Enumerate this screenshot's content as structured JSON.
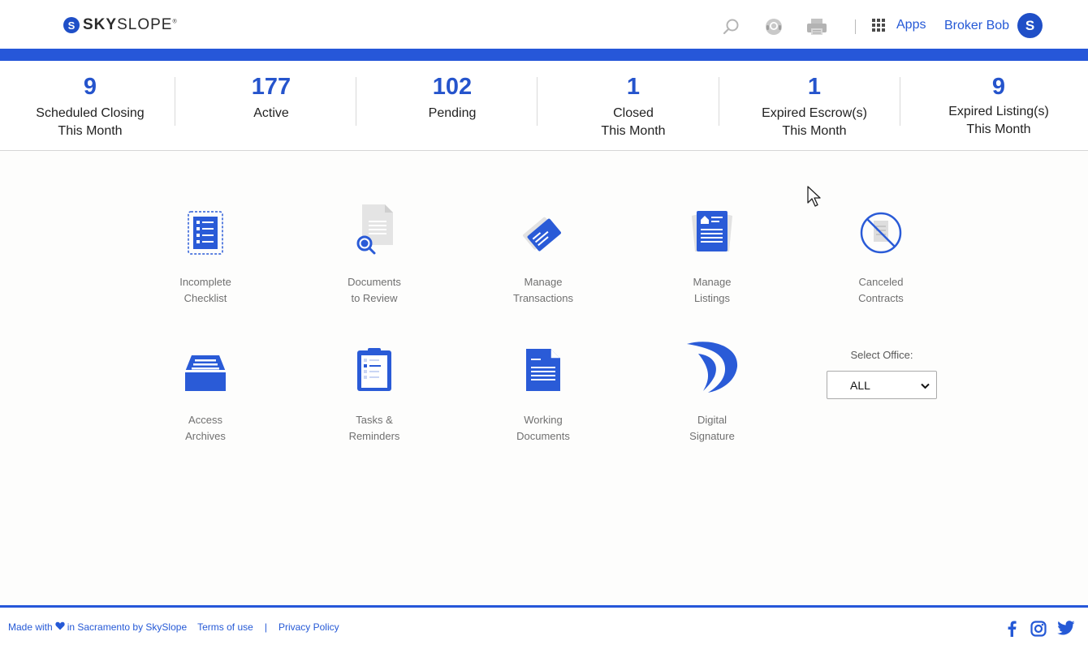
{
  "brand": {
    "logo_text_bold": "SKY",
    "logo_text_light": "SLOPE",
    "registered": "®"
  },
  "header": {
    "apps_label": "Apps",
    "user_name": "Broker Bob",
    "accent": "#2657d9"
  },
  "stats": [
    {
      "value": "9",
      "label_line1": "Scheduled Closing",
      "label_line2": "This Month"
    },
    {
      "value": "177",
      "label_line1": "Active",
      "label_line2": ""
    },
    {
      "value": "102",
      "label_line1": "Pending",
      "label_line2": ""
    },
    {
      "value": "1",
      "label_line1": "Closed",
      "label_line2": "This Month"
    },
    {
      "value": "1",
      "label_line1": "Expired Escrow(s)",
      "label_line2": "This Month"
    },
    {
      "value": "9",
      "label_line1": "Expired Listing(s)",
      "label_line2": "This Month"
    }
  ],
  "tiles": [
    {
      "icon": "checklist-icon",
      "line1": "Incomplete",
      "line2": "Checklist"
    },
    {
      "icon": "document-review-icon",
      "line1": "Documents",
      "line2": "to Review"
    },
    {
      "icon": "transactions-icon",
      "line1": "Manage",
      "line2": "Transactions"
    },
    {
      "icon": "listings-icon",
      "line1": "Manage",
      "line2": "Listings"
    },
    {
      "icon": "canceled-contract-icon",
      "line1": "Canceled",
      "line2": "Contracts"
    },
    {
      "icon": "archive-icon",
      "line1": "Access",
      "line2": "Archives"
    },
    {
      "icon": "tasks-icon",
      "line1": "Tasks &",
      "line2": "Reminders"
    },
    {
      "icon": "working-documents-icon",
      "line1": "Working",
      "line2": "Documents"
    },
    {
      "icon": "digital-signature-icon",
      "line1": "Digital",
      "line2": "Signature"
    }
  ],
  "office": {
    "label": "Select Office:",
    "selected": "ALL"
  },
  "footer": {
    "made_with": "Made with",
    "in_text": "in Sacramento by SkySlope",
    "terms": "Terms of use",
    "separator": "|",
    "privacy": "Privacy Policy"
  }
}
